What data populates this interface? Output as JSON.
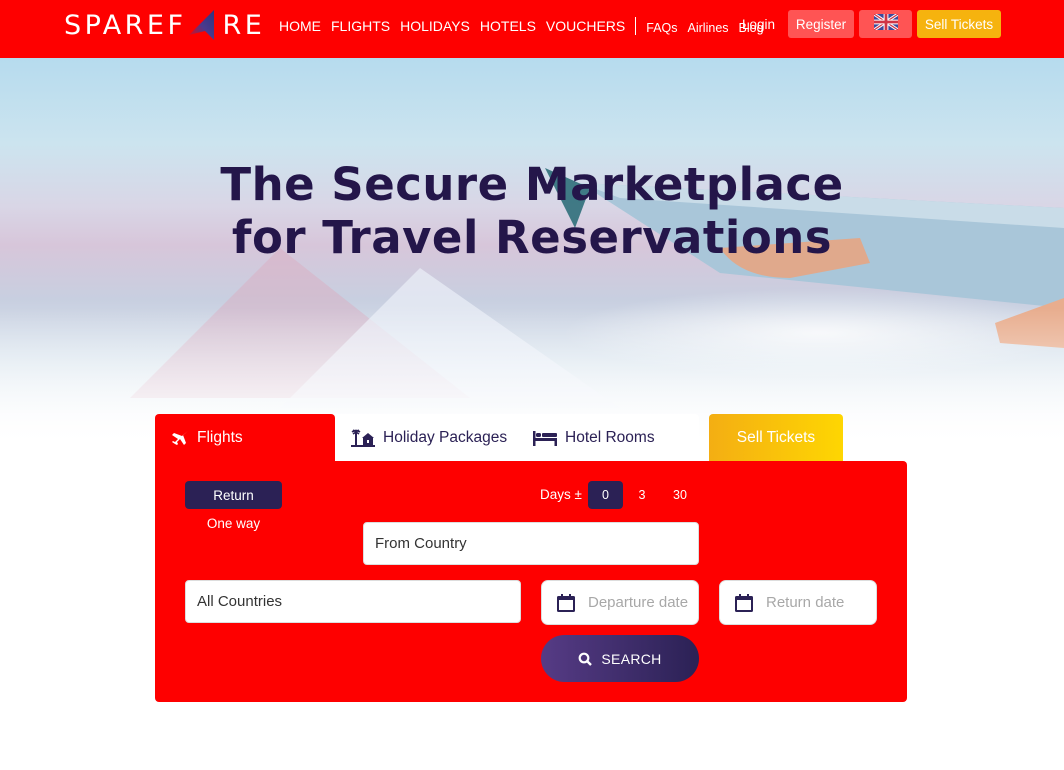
{
  "header": {
    "logo": {
      "left": "SPAREF",
      "right": "RE"
    },
    "nav_main": [
      "HOME",
      "FLIGHTS",
      "HOLIDAYS",
      "HOTELS",
      "VOUCHERS"
    ],
    "nav_sub": [
      "FAQs",
      "Airlines",
      "Blog"
    ],
    "login": "Login",
    "register": "Register",
    "language_icon": "uk-flag-icon",
    "sell_tickets": "Sell Tickets"
  },
  "hero": {
    "title_line1": "The Secure Marketplace",
    "title_line2": "for Travel Reservations"
  },
  "tabs": {
    "flights": "Flights",
    "holiday_packages": "Holiday Packages",
    "hotel_rooms": "Hotel Rooms",
    "sell_tickets": "Sell Tickets",
    "active": "Flights"
  },
  "search_form": {
    "trip_type": {
      "selected": "Return",
      "options": [
        "Return",
        "One way"
      ]
    },
    "days_label": "Days ±",
    "days_options": [
      "0",
      "3",
      "30"
    ],
    "days_selected": "0",
    "from_country": "From Country",
    "to_country": "All Countries",
    "departure_placeholder": "Departure date",
    "return_placeholder": "Return date",
    "search_button": "SEARCH"
  },
  "colors": {
    "brand_red": "#fe0000",
    "navy": "#2b2155",
    "gold": "#f6b30e",
    "register_bg": "#ff5454"
  }
}
